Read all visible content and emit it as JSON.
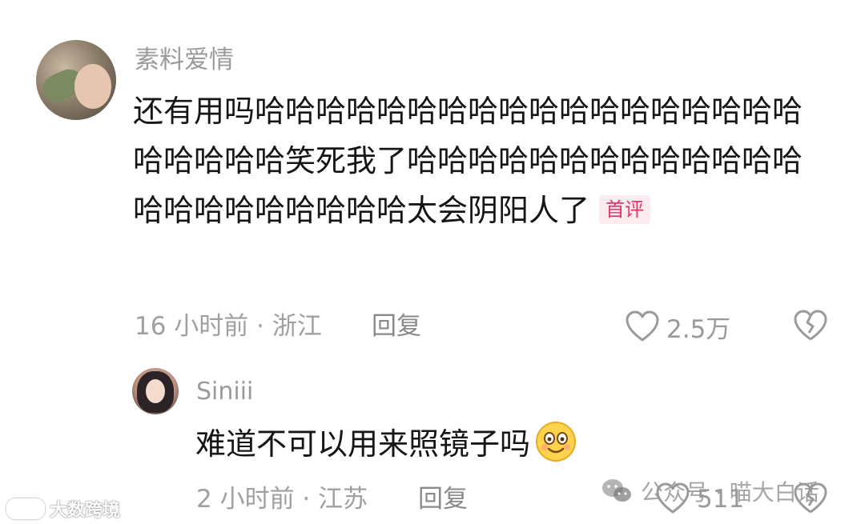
{
  "comments": [
    {
      "username": "素料爱情",
      "text": "还有用吗哈哈哈哈哈哈哈哈哈哈哈哈哈哈哈哈哈哈哈哈哈哈哈笑死我了哈哈哈哈哈哈哈哈哈哈哈哈哈哈哈哈哈哈哈哈哈哈太会阴阳人了",
      "badge": "首评",
      "meta": "16 小时前 · 浙江",
      "reply_label": "回复",
      "likes": "2.5万",
      "badge_color": "#e8336a"
    },
    {
      "username": "Siniii",
      "text": "难道不可以用来照镜子吗",
      "emoji": "smiling-face-emoji",
      "meta": "2 小时前 · 江苏",
      "reply_label": "回复",
      "likes": "511"
    }
  ],
  "watermarks": {
    "left": "大数跨境",
    "right": "公众号 · 喵大白话"
  },
  "colors": {
    "text": "#161616",
    "meta": "#a0a0a0",
    "username": "#9b9b9b"
  }
}
